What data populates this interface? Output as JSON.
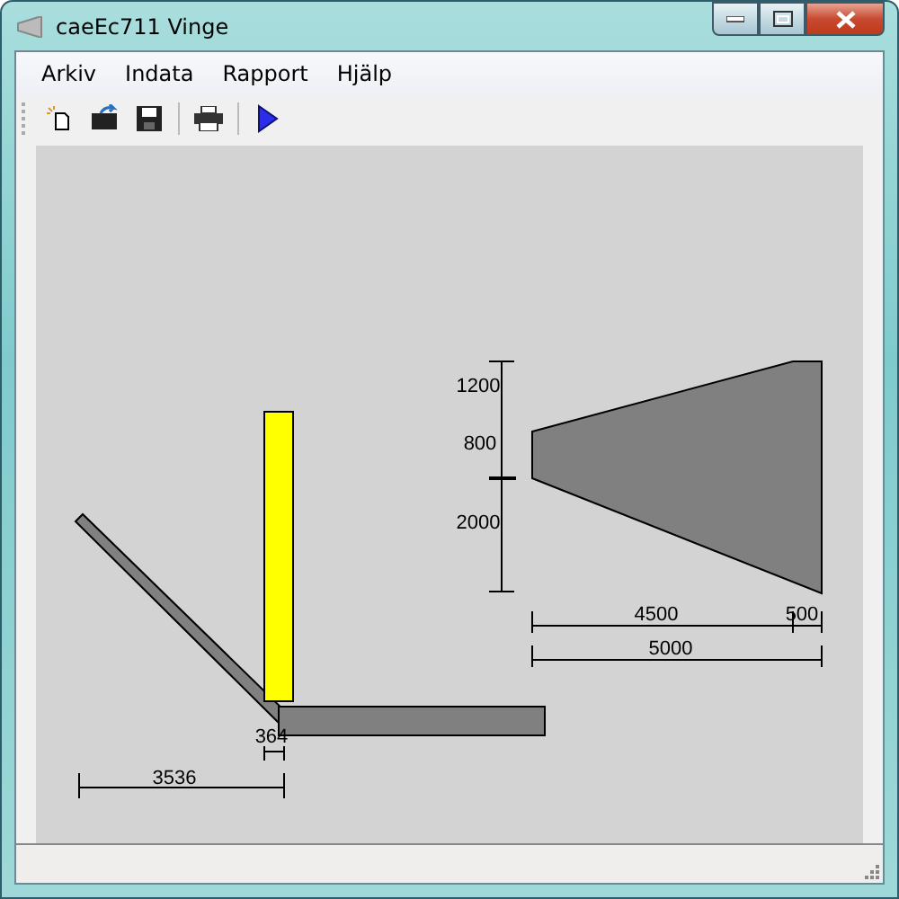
{
  "window": {
    "title": "caeEc711 Vinge"
  },
  "menu": [
    "Arkiv",
    "Indata",
    "Rapport",
    "Hjälp"
  ],
  "drawing": {
    "dimension_labels": [
      "1200",
      "800",
      "2000",
      "4500",
      "500",
      "5000",
      "364",
      "3536"
    ]
  }
}
